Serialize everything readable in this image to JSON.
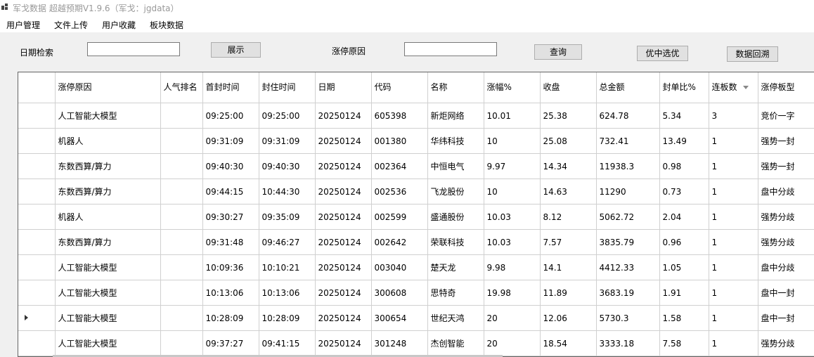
{
  "window": {
    "title": "军戈数据 超越预期V1.9.6（军戈：jgdata）"
  },
  "menu": {
    "items": [
      "用户管理",
      "文件上传",
      "用户收藏",
      "板块数据"
    ]
  },
  "search": {
    "date_label": "日期检索",
    "date_value": "",
    "show_button": "展示",
    "reason_label": "涨停原因",
    "reason_value": "",
    "query_button": "查询",
    "select_button": "优中选优",
    "backtrack_button": "数据回溯"
  },
  "grid": {
    "columns": [
      "涨停原因",
      "人气排名",
      "首封时间",
      "封住时间",
      "日期",
      "代码",
      "名称",
      "涨幅%",
      "收盘",
      "总金额",
      "封单比%",
      "连板数",
      "涨停板型"
    ],
    "sorted_column": "连板数",
    "selected_row": 8,
    "rows": [
      [
        "人工智能大模型",
        "",
        "09:25:00",
        "09:25:00",
        "20250124",
        "605398",
        "新炬网络",
        "10.01",
        "25.38",
        "624.78",
        "5.34",
        "3",
        "竞价一字"
      ],
      [
        "机器人",
        "",
        "09:31:09",
        "09:31:09",
        "20250124",
        "001380",
        "华纬科技",
        "10",
        "25.08",
        "732.41",
        "13.49",
        "1",
        "强势一封"
      ],
      [
        "东数西算/算力",
        "",
        "09:40:30",
        "09:40:30",
        "20250124",
        "002364",
        "中恒电气",
        "9.97",
        "14.34",
        "11938.3",
        "0.98",
        "1",
        "强势一封"
      ],
      [
        "东数西算/算力",
        "",
        "09:44:15",
        "10:44:30",
        "20250124",
        "002536",
        "飞龙股份",
        "10",
        "14.63",
        "11290",
        "0.73",
        "1",
        "盘中分歧"
      ],
      [
        "机器人",
        "",
        "09:30:27",
        "09:35:09",
        "20250124",
        "002599",
        "盛通股份",
        "10.03",
        "8.12",
        "5062.72",
        "2.04",
        "1",
        "强势分歧"
      ],
      [
        "东数西算/算力",
        "",
        "09:31:48",
        "09:46:27",
        "20250124",
        "002642",
        "荣联科技",
        "10.03",
        "7.57",
        "3835.79",
        "0.96",
        "1",
        "强势分歧"
      ],
      [
        "人工智能大模型",
        "",
        "10:09:36",
        "10:10:21",
        "20250124",
        "003040",
        "楚天龙",
        "9.98",
        "14.1",
        "4412.33",
        "1.05",
        "1",
        "盘中分歧"
      ],
      [
        "人工智能大模型",
        "",
        "10:13:06",
        "10:13:06",
        "20250124",
        "300608",
        "思特奇",
        "19.98",
        "11.89",
        "3683.19",
        "1.91",
        "1",
        "盘中一封"
      ],
      [
        "人工智能大模型",
        "",
        "10:28:09",
        "10:28:09",
        "20250124",
        "300654",
        "世纪天鸿",
        "20",
        "12.06",
        "5730.3",
        "1.58",
        "1",
        "盘中一封"
      ],
      [
        "人工智能大模型",
        "",
        "09:37:27",
        "09:41:15",
        "20250124",
        "301248",
        "杰创智能",
        "20",
        "18.54",
        "3333.18",
        "7.58",
        "1",
        "强势分歧"
      ]
    ]
  }
}
